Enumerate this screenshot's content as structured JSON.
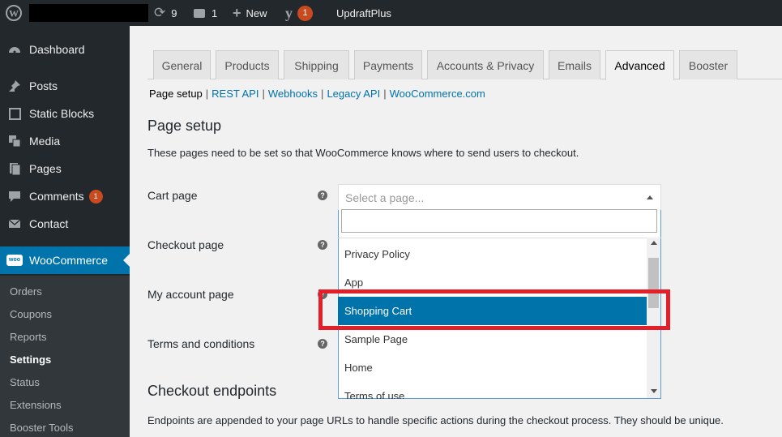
{
  "adminbar": {
    "updates_count": "9",
    "comments_count": "1",
    "new_label": "New",
    "seo_badge": "1",
    "plugin_label": "UpdraftPlus"
  },
  "sidebar": {
    "items": [
      {
        "label": "Dashboard",
        "icon": "dashboard-icon"
      },
      {
        "label": "Posts",
        "icon": "pushpin-icon"
      },
      {
        "label": "Static Blocks",
        "icon": "square-icon"
      },
      {
        "label": "Media",
        "icon": "media-icon"
      },
      {
        "label": "Pages",
        "icon": "pages-icon"
      },
      {
        "label": "Comments",
        "icon": "comment-icon",
        "badge": "1"
      },
      {
        "label": "Contact",
        "icon": "envelope-icon"
      },
      {
        "label": "WooCommerce",
        "icon": "woo-icon"
      }
    ],
    "submenu": [
      "Orders",
      "Coupons",
      "Reports",
      "Settings",
      "Status",
      "Extensions",
      "Booster Tools"
    ]
  },
  "tabs": [
    "General",
    "Products",
    "Shipping",
    "Payments",
    "Accounts & Privacy",
    "Emails",
    "Advanced",
    "Booster"
  ],
  "subnav": [
    "Page setup",
    "REST API",
    "Webhooks",
    "Legacy API",
    "WooCommerce.com"
  ],
  "page_setup": {
    "heading": "Page setup",
    "description": "These pages need to be set so that WooCommerce knows where to send users to checkout.",
    "fields": [
      "Cart page",
      "Checkout page",
      "My account page",
      "Terms and conditions"
    ],
    "select_placeholder": "Select a page...",
    "search_value": "",
    "options": [
      "Privacy Policy",
      "App",
      "Shopping Cart",
      "Sample Page",
      "Home",
      "Terms of use"
    ],
    "highlighted_option": "Shopping Cart"
  },
  "endpoints": {
    "heading": "Checkout endpoints",
    "description": "Endpoints are appended to your page URLs to handle specific actions during the checkout process. They should be unique."
  },
  "colors": {
    "admin_dark": "#23282d",
    "accent": "#0073aa",
    "badge": "#ca4a1f",
    "annotation_red": "#e3202a"
  }
}
